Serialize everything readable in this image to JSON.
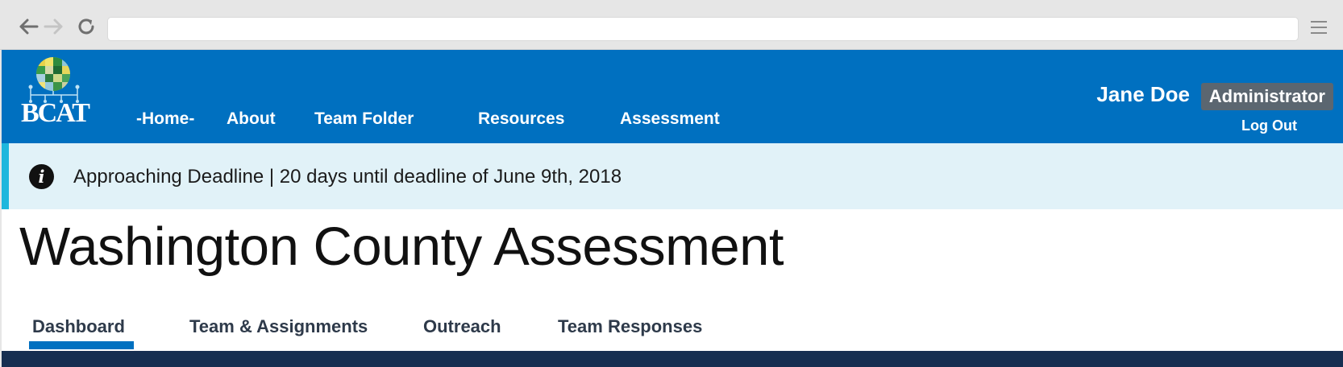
{
  "browser": {
    "back_icon": "arrow-left-icon",
    "forward_icon": "arrow-right-icon",
    "reload_icon": "reload-icon",
    "address_value": "",
    "menu_icon": "hamburger-menu-icon"
  },
  "header": {
    "logo_text": "BCAT",
    "nav": [
      {
        "label": "-Home-"
      },
      {
        "label": "About"
      },
      {
        "label": "Team Folder"
      },
      {
        "label": "Resources"
      },
      {
        "label": "Assessment"
      }
    ],
    "user_name": "Jane Doe",
    "role": "Administrator",
    "logout_label": "Log Out"
  },
  "alert": {
    "icon": "info-icon",
    "text": "Approaching Deadline | 20 days until deadline of June 9th, 2018"
  },
  "page": {
    "title": "Washington County Assessment"
  },
  "tabs": [
    {
      "label": "Dashboard",
      "active": true
    },
    {
      "label": "Team & Assignments",
      "active": false
    },
    {
      "label": "Outreach",
      "active": false
    },
    {
      "label": "Team Responses",
      "active": false
    }
  ],
  "colors": {
    "header_blue": "#0070c0",
    "alert_bg": "#e1f2f8",
    "alert_accent": "#1fb7dd",
    "role_badge": "#5b6670",
    "bottom_band": "#162e51"
  }
}
